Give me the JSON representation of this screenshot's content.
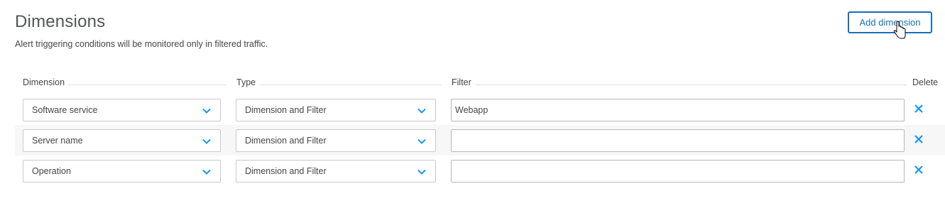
{
  "section": {
    "title": "Dimensions",
    "subtitle": "Alert triggering conditions will be monitored only in filtered traffic.",
    "add_button_label": "Add dimension"
  },
  "columns": {
    "dimension": "Dimension",
    "type": "Type",
    "filter": "Filter",
    "delete": "Delete"
  },
  "rows": [
    {
      "dimension": "Software service",
      "type": "Dimension and Filter",
      "filter": "Webapp"
    },
    {
      "dimension": "Server name",
      "type": "Dimension and Filter",
      "filter": ""
    },
    {
      "dimension": "Operation",
      "type": "Dimension and Filter",
      "filter": ""
    }
  ],
  "colors": {
    "accent": "#1a6fb3",
    "icon_blue": "#1496ff",
    "row_alt_bg": "#f7f7f7"
  },
  "icons": {
    "dropdown": "chevron-down-icon",
    "delete": "close-icon",
    "cursor": "hand-pointer-icon"
  }
}
